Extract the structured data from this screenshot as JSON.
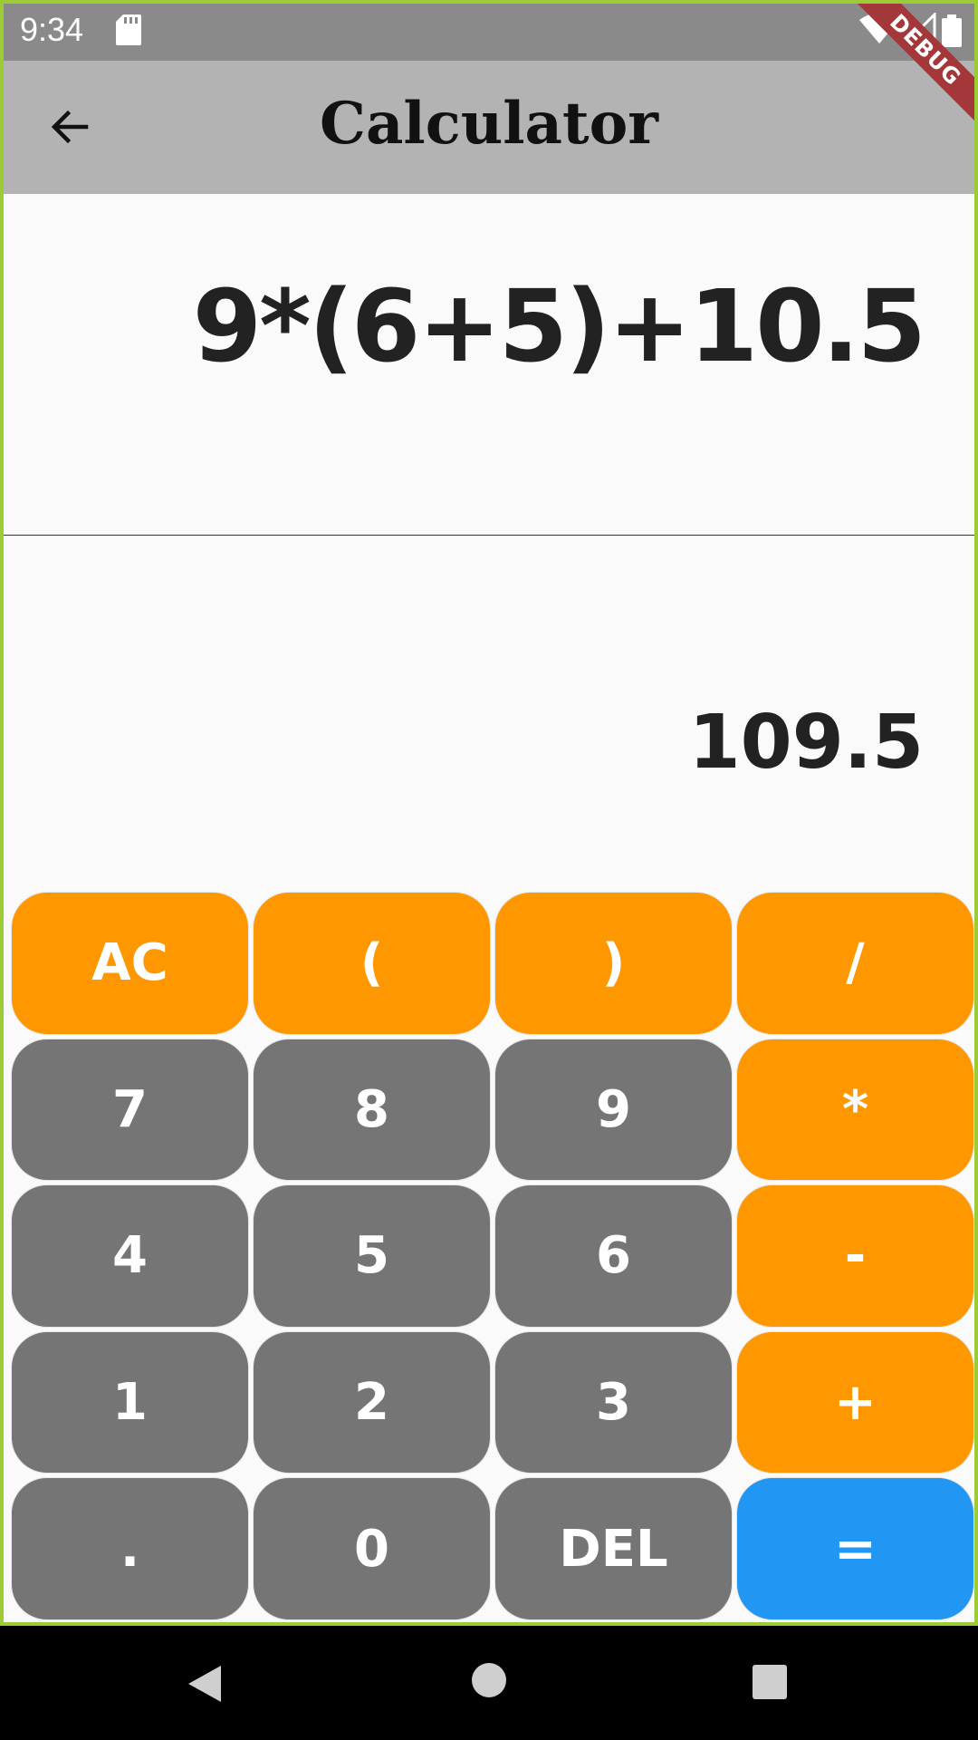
{
  "status_bar": {
    "time": "9:34",
    "icons": [
      "sd-card-icon",
      "wifi-icon",
      "cell-signal-icon",
      "battery-icon"
    ]
  },
  "app_bar": {
    "title": "Calculator",
    "back_icon": "arrow-back-icon"
  },
  "debug_banner": "DEBUG",
  "display": {
    "expression": "9*(6+5)+10.5",
    "result": "109.5"
  },
  "keypad": {
    "keys": [
      "AC",
      "(",
      ")",
      "/",
      "7",
      "8",
      "9",
      "*",
      "4",
      "5",
      "6",
      "-",
      "1",
      "2",
      "3",
      "+",
      ".",
      "0",
      "DEL",
      "="
    ]
  },
  "colors": {
    "operator": "#ff9800",
    "number": "#757575",
    "equals": "#2196f3",
    "app_bar": "#b3b3b3",
    "status_bar": "#8a8a8a"
  },
  "nav_bar": {
    "icons": [
      "nav-back-icon",
      "nav-home-icon",
      "nav-recents-icon"
    ]
  }
}
